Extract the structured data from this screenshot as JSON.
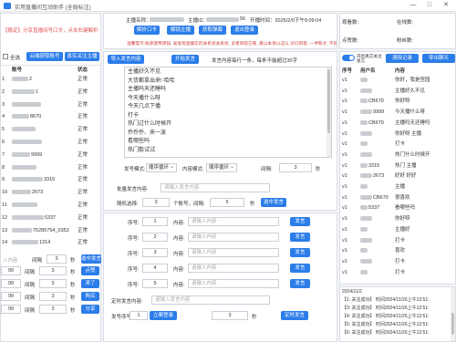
{
  "window": {
    "title": "实用直播间互动助手 (全局标注)",
    "min": "—",
    "max": "□",
    "close": "✕"
  },
  "left": {
    "notice": "【稳定】分享直播间号口令，点击右键解析",
    "buttons": {
      "select_all": "全选",
      "cloud_account": "云端获取账号",
      "real_follow": "真实关注主播"
    },
    "table_headers": {
      "index": "",
      "account": "账号",
      "status": "状态"
    },
    "rows": [
      {
        "no": "1",
        "account": "2",
        "status": "正常"
      },
      {
        "no": "2",
        "account": "1",
        "status": "正常"
      },
      {
        "no": "3",
        "account": "",
        "status": "正常"
      },
      {
        "no": "4",
        "account": "8670",
        "status": "正常"
      },
      {
        "no": "5",
        "account": "",
        "status": "正常"
      },
      {
        "no": "6",
        "account": "",
        "status": "正常"
      },
      {
        "no": "7",
        "account": "9999",
        "status": "正常"
      },
      {
        "no": "8",
        "account": "",
        "status": "正常"
      },
      {
        "no": "9",
        "account": "3315",
        "status": "正常"
      },
      {
        "no": "10",
        "account": "2673",
        "status": "正常"
      },
      {
        "no": "11",
        "account": "",
        "status": "正常"
      },
      {
        "no": "12",
        "account": "5337",
        "status": "正常"
      },
      {
        "no": "13",
        "account": "75285754_0352",
        "status": "正常"
      },
      {
        "no": "14",
        "account": "1314",
        "status": "正常"
      }
    ],
    "input_placeholder": "入内容",
    "interval_label": "间隔",
    "interval_value": "3",
    "sec_label": "秒",
    "send_button": "选中发言",
    "bottom_rows": [
      {
        "value": "99",
        "interval_label": "间隔",
        "interval": "3",
        "sec": "秒",
        "button": "点赞"
      },
      {
        "value": "99",
        "interval_label": "间隔",
        "interval": "3",
        "sec": "秒",
        "button": "来了"
      },
      {
        "value": "99",
        "interval_label": "间隔",
        "interval": "3",
        "sec": "秒",
        "button": "购买"
      },
      {
        "value": "99",
        "interval_label": "间隔",
        "interval": "3",
        "sec": "秒",
        "button": "分享"
      }
    ]
  },
  "top": {
    "anchor_name_label": "主播名称：",
    "anchor_id_label": "主播ID：",
    "anchor_id_tail": "56",
    "open_time": "开播时间：2025/2/9下午9:09:04",
    "tip": "温馨提示:收获使用须知, 发发现直播实的关系状关系状, 多者目前已看, 再以本身以这以 对口到客, 一伴和才, 不倍",
    "buttons": {
      "parse": "解析口令",
      "unfollow": "解锁主播",
      "switch": "获取弹幕",
      "quit": "退出登录"
    }
  },
  "stats": {
    "viewers_label": "观看数:",
    "viewers_value": "",
    "online_label": "在线数:",
    "online_value": "",
    "likes_label": "点赞数:",
    "likes_value": "",
    "fans_label": "粉丝数:",
    "fans_value": ""
  },
  "middle": {
    "btn_import": "导入发言内容",
    "btn_start": "开始发言",
    "hint": "发言内容每行一条，每条不能超过30字",
    "messages": [
      "主播好久不见",
      "大货都拿出来! 哈哈",
      "主播吗天还睡吗",
      "今天播什么呀",
      "今天几点下播",
      "打卡",
      "热门过什么时候开",
      "乔乔乔、来一波",
      "看哪些吗",
      "热门数试试"
    ],
    "mode_label": "发号模式:",
    "mode_value": "顺序循环",
    "content_mode_label": "内容模式:",
    "content_mode_value": "顺序循环",
    "interval_label": "间隔:",
    "interval_value": "3",
    "sec_label": "秒",
    "batch_label": "批量发言内容:",
    "batch_placeholder": "请输入发言内容",
    "random_label": "随机选择:",
    "random_from": "3",
    "random_mid": "个账号，间隔:",
    "random_interval": "5",
    "random_sec": "秒",
    "random_btn": "选中发言"
  },
  "seq": {
    "rows": [
      {
        "label": "序号:",
        "no": "1",
        "content_label": "内容:",
        "placeholder": "请输入内容",
        "button": "发言"
      },
      {
        "label": "序号:",
        "no": "2",
        "content_label": "内容:",
        "placeholder": "请输入内容",
        "button": "发言"
      },
      {
        "label": "序号:",
        "no": "3",
        "content_label": "内容:",
        "placeholder": "请输入内容",
        "button": "发言"
      },
      {
        "label": "序号:",
        "no": "4",
        "content_label": "内容:",
        "placeholder": "请输入内容",
        "button": "发言"
      },
      {
        "label": "序号:",
        "no": "5",
        "content_label": "内容:",
        "placeholder": "请输入内容",
        "button": "发言"
      }
    ],
    "timed_label": "定时发言内容:",
    "timed_placeholder": "请输入发言内容",
    "send_label": "发号序号:",
    "send_no": "1",
    "send_btn": "立案登录",
    "sec_label": "秒",
    "timed_btn": "定时发言",
    "timed_interval": "3"
  },
  "right": {
    "toggle_label": "开启真实关注发言",
    "clear_btn": "清除记录",
    "export_btn": "导出聊天",
    "headers": {
      "no": "序号",
      "user": "用户名",
      "content": "内容"
    },
    "rows": [
      {
        "no": "v1",
        "user": "",
        "content": "你好，我是宫园"
      },
      {
        "no": "v1",
        "user": "",
        "content": "主播好久不见"
      },
      {
        "no": "v1",
        "user": "CB670",
        "content": "你好呀"
      },
      {
        "no": "v1",
        "user": "9999",
        "content": "今天播什么呀"
      },
      {
        "no": "v1",
        "user": "CB670",
        "content": "主播吗天还睡吗"
      },
      {
        "no": "v1",
        "user": "",
        "content": "你好呀 主播"
      },
      {
        "no": "v1",
        "user": "",
        "content": "打卡"
      },
      {
        "no": "v1",
        "user": "",
        "content": "热门什么时候开"
      },
      {
        "no": "v1",
        "user": "3315",
        "content": "热门 主播"
      },
      {
        "no": "v1",
        "user": "2673",
        "content": "好好 好好"
      },
      {
        "no": "v1",
        "user": "",
        "content": "主播"
      },
      {
        "no": "v1",
        "user": "CB670",
        "content": "很喜欢"
      },
      {
        "no": "v1",
        "user": "5337",
        "content": "看哪些吗"
      },
      {
        "no": "v1",
        "user": "",
        "content": "你好呀"
      },
      {
        "no": "v1",
        "user": "",
        "content": "主播好"
      },
      {
        "no": "v1",
        "user": "",
        "content": "打卡"
      },
      {
        "no": "v1",
        "user": "",
        "content": "喜欢"
      },
      {
        "no": "v1",
        "user": "",
        "content": "打卡"
      },
      {
        "no": "v1",
        "user": "",
        "content": "打卡"
      }
    ],
    "log": [
      "2024/11/2",
      "【1: 关注成功】 时间2024/11/26上午12:51:",
      "【3: 关注成功】 时间2024/11/26上午12:51:",
      "【4: 关注成功】 时间2024/11/26上午12:51:",
      "【5: 关注成功】 时间2024/11/26上午12:51:",
      "【6: 关注成功】 时间2024/11/26上午12:51:"
    ]
  }
}
